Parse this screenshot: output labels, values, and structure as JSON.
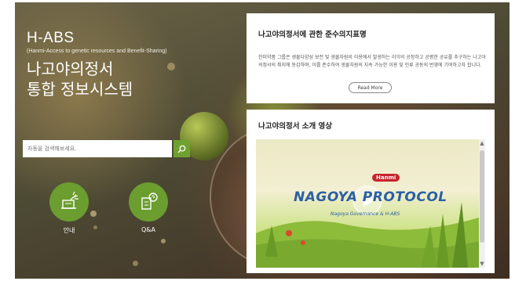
{
  "brand": {
    "logo": "H-ABS",
    "subtitle": "(Hanmi-Access to genetic resources and Benefit-Sharing)",
    "title_line1": "나고야의정서",
    "title_line2": "통합 정보시스템"
  },
  "search": {
    "placeholder": "자동을 검색해보세요."
  },
  "quick_links": [
    {
      "label": "안내",
      "icon": "megaphone-icon"
    },
    {
      "label": "Q&A",
      "icon": "chat-question-icon"
    }
  ],
  "notice_card": {
    "heading": "나고야의정서에 관한 준수의지표명",
    "body": "한미약품 그룹은 생물다양성 보전 및 생물자원의 이용에서 발생하는 이익의 공정하고 공평한 공유를 추구하는 나고야의정서의 취지에 동감하며, 이를 준수하여 생물자원의 지속 가능한 이용 및 인류 공동의 번영에 기여하고자 합니다.",
    "button": "Read More"
  },
  "video_card": {
    "heading": "나고야의정서 소개 영상",
    "video_brand": "Hanmi",
    "video_title": "NAGOYA PROTOCOL",
    "video_subtitle": "Nagoya Governance & H-ABS"
  },
  "colors": {
    "accent_green": "#6fa131",
    "circle_green": "#6b9d2f"
  }
}
